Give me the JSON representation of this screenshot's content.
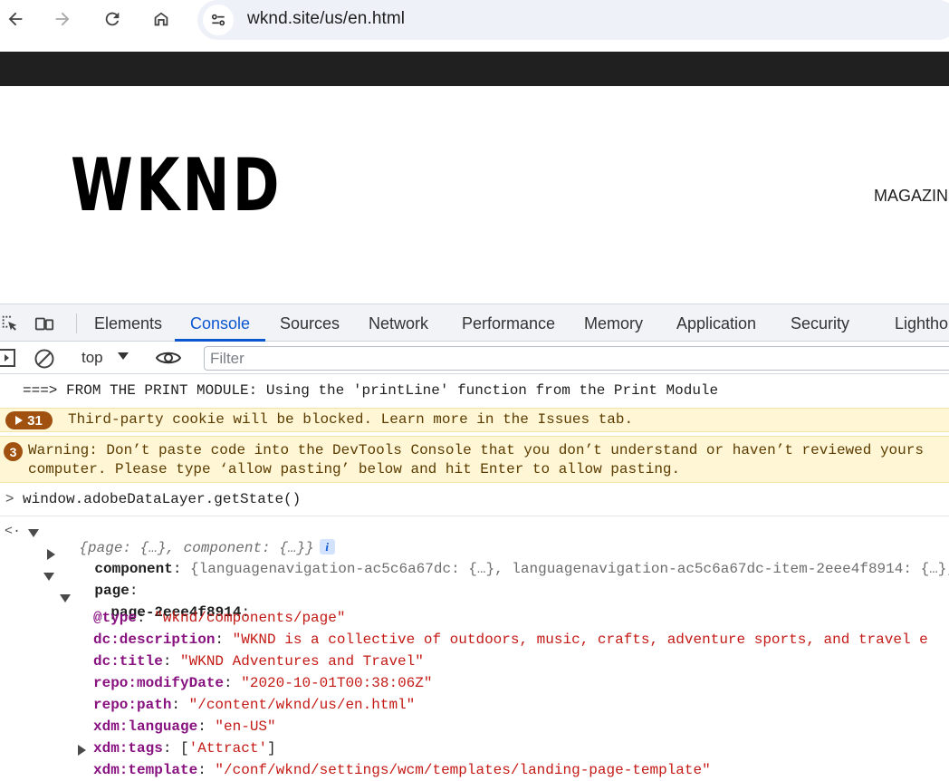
{
  "browser": {
    "url": "wknd.site/us/en.html"
  },
  "site": {
    "logo": "WKND",
    "nav_item": "MAGAZIN"
  },
  "devtools": {
    "tabs": [
      "Elements",
      "Console",
      "Sources",
      "Network",
      "Performance",
      "Memory",
      "Application",
      "Security",
      "Lightho"
    ],
    "active_tab": "Console",
    "context": "top",
    "filter_placeholder": "Filter",
    "messages": {
      "print": "===> FROM THE PRINT MODULE: Using the 'printLine' function from the Print Module",
      "cookie_count": "31",
      "cookie": "Third-party cookie will be blocked. Learn more in the Issues tab.",
      "warn_count": "3",
      "warn_line1": "Warning: Don’t paste code into the DevTools Console that you don’t understand or haven’t reviewed yours",
      "warn_line2": "computer. Please type ‘allow pasting’ below and hit Enter to allow pasting.",
      "input": "window.adobeDataLayer.getState()"
    },
    "result": {
      "summary": "{page: {…}, component: {…}}",
      "component_key": "component",
      "component_preview": "{languagenavigation-ac5c6a67dc: {…}, languagenavigation-ac5c6a67dc-item-2eee4f8914: {…},",
      "page_key": "page",
      "page_id_key": "page-2eee4f8914",
      "props": [
        {
          "key": "@type",
          "value": "\"wknd/components/page\""
        },
        {
          "key": "dc:description",
          "value": "\"WKND is a collective of outdoors, music, crafts, adventure sports, and travel e"
        },
        {
          "key": "dc:title",
          "value": "\"WKND Adventures and Travel\""
        },
        {
          "key": "repo:modifyDate",
          "value": "\"2020-10-01T00:38:06Z\""
        },
        {
          "key": "repo:path",
          "value": "\"/content/wknd/us/en.html\""
        },
        {
          "key": "xdm:language",
          "value": "\"en-US\""
        },
        {
          "key": "xdm:tags",
          "value": "'Attract'"
        },
        {
          "key": "xdm:template",
          "value": "\"/conf/wknd/settings/wcm/templates/landing-page-template\""
        }
      ]
    }
  }
}
